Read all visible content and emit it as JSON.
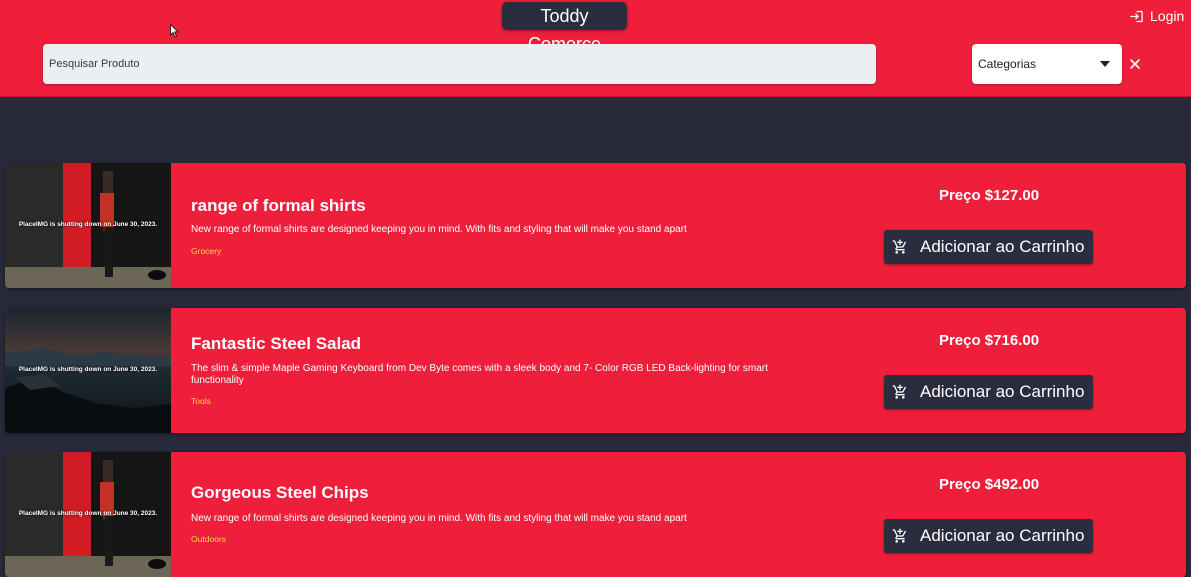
{
  "header": {
    "brand": "Toddy Comerce",
    "login_label": "Login",
    "search_placeholder": "Pesquisar Produto",
    "category_select_label": "Categorias"
  },
  "products": [
    {
      "title": "range of formal shirts",
      "description": "New range of formal shirts are designed keeping you in mind. With fits and styling that will make you stand apart",
      "category": "Grocery",
      "price": "Preço $127.00",
      "image_caption": "PlaceIMG is shutting down on June 30, 2023.",
      "cart_label": "Adicionar ao Carrinho"
    },
    {
      "title": "Fantastic Steel Salad",
      "description": "The slim & simple Maple Gaming Keyboard from Dev Byte comes with a sleek body and 7- Color RGB LED Back-lighting for smart functionality",
      "category": "Tools",
      "price": "Preço $716.00",
      "image_caption": "PlaceIMG is shutting down on June 30, 2023.",
      "cart_label": "Adicionar ao Carrinho"
    },
    {
      "title": "Gorgeous Steel Chips",
      "description": "New range of formal shirts are designed keeping you in mind. With fits and styling that will make you stand apart",
      "category": "Outdoors",
      "price": "Preço $492.00",
      "image_caption": "PlaceIMG is shutting down on June 30, 2023.",
      "cart_label": "Adicionar ao Carrinho"
    }
  ],
  "colors": {
    "primary": "#ef1f3b",
    "dark": "#282a3a",
    "button": "#2b2d3f",
    "category_text": "#ffd54a"
  },
  "icons": [
    "login-icon",
    "dropdown-caret-icon",
    "close-icon",
    "add-to-cart-icon",
    "mouse-cursor-icon"
  ]
}
